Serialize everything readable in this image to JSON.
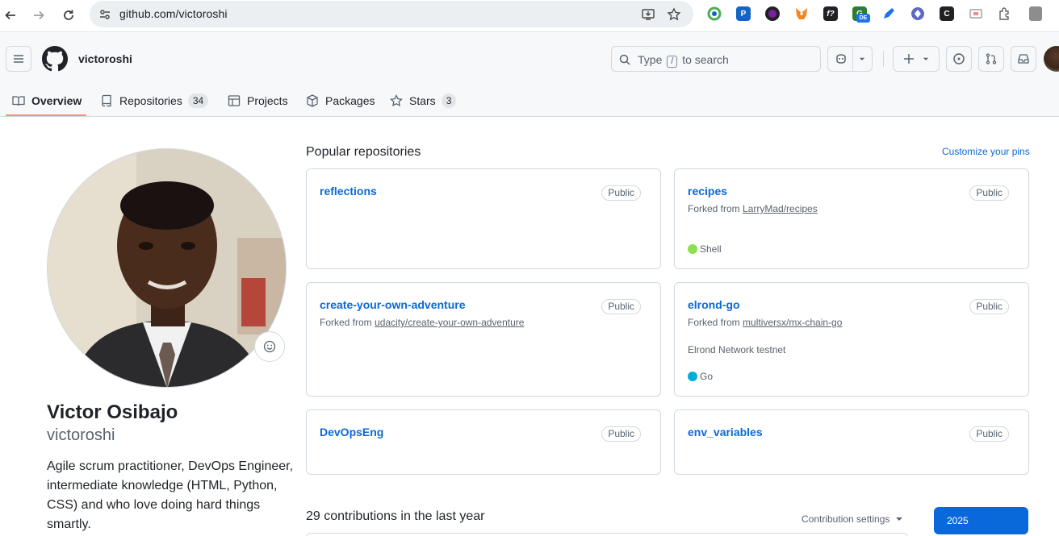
{
  "browser": {
    "url": "github.com/victoroshi",
    "extensions": [
      {
        "icon": "chrome-extension-1-icon",
        "color": "#4caf50"
      },
      {
        "icon": "chrome-extension-2-icon",
        "color": "#1565c0"
      },
      {
        "icon": "chrome-extension-3-icon",
        "color": "#7b1fa2"
      },
      {
        "icon": "metamask-icon",
        "color": "#f6851b"
      },
      {
        "icon": "formula-icon",
        "color": "#202124"
      },
      {
        "icon": "translate-icon",
        "color": "#2e7d32"
      },
      {
        "icon": "pen-icon",
        "color": "#1a73e8"
      },
      {
        "icon": "diamond-icon",
        "color": "#5c6bc0"
      },
      {
        "icon": "c-icon",
        "color": "#202124"
      },
      {
        "icon": "cast-icon",
        "color": "#9e9e9e"
      },
      {
        "icon": "puzzle-icon",
        "color": "#5f6368"
      }
    ],
    "ext_badge": "DE"
  },
  "header": {
    "username": "victoroshi",
    "search": {
      "prefix": "Type",
      "key": "/",
      "suffix": "to search"
    }
  },
  "tabs": [
    {
      "label": "Overview",
      "icon": "book-icon"
    },
    {
      "label": "Repositories",
      "count": "34",
      "icon": "repo-icon"
    },
    {
      "label": "Projects",
      "icon": "table-icon"
    },
    {
      "label": "Packages",
      "icon": "package-icon"
    },
    {
      "label": "Stars",
      "count": "3",
      "icon": "star-icon"
    }
  ],
  "profile": {
    "name": "Victor Osibajo",
    "login": "victoroshi",
    "bio": "Agile scrum practitioner, DevOps Engineer, intermediate knowledge (HTML, Python, CSS) and who love doing hard things smartly."
  },
  "popular": {
    "title": "Popular repositories",
    "customize": "Customize your pins",
    "repos": [
      {
        "name": "reflections",
        "visibility": "Public"
      },
      {
        "name": "recipes",
        "visibility": "Public",
        "fork_prefix": "Forked from",
        "fork_source": "LarryMad/recipes",
        "language": "Shell",
        "lang_color": "#89e051"
      },
      {
        "name": "create-your-own-adventure",
        "visibility": "Public",
        "fork_prefix": "Forked from",
        "fork_source": "udacity/create-your-own-adventure"
      },
      {
        "name": "elrond-go",
        "visibility": "Public",
        "fork_prefix": "Forked from",
        "fork_source": "multiversx/mx-chain-go",
        "description": "Elrond Network testnet",
        "language": "Go",
        "lang_color": "#00add8"
      },
      {
        "name": "DevOpsEng",
        "visibility": "Public"
      },
      {
        "name": "env_variables",
        "visibility": "Public"
      }
    ]
  },
  "contributions": {
    "title": "29 contributions in the last year",
    "settings": "Contribution settings",
    "year": "2025"
  }
}
